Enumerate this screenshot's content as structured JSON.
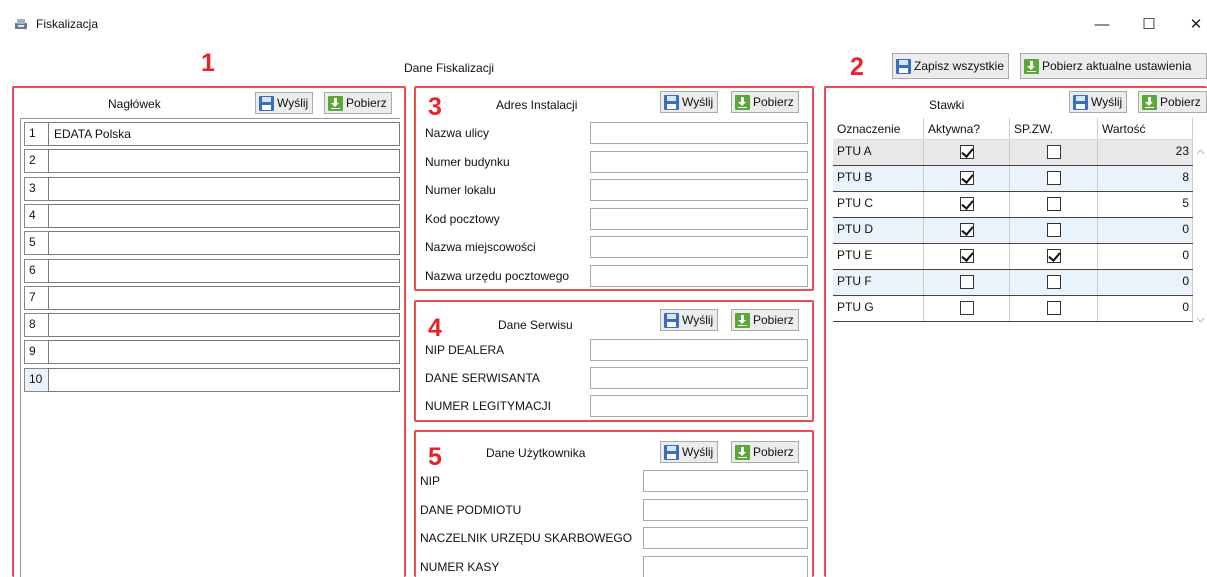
{
  "window": {
    "title": "Fiskalizacja",
    "controls": {
      "minimize": "—",
      "maximize": "☐",
      "close": "✕"
    }
  },
  "main": {
    "center_title": "Dane Fiskalizacji",
    "save_all_label": "Zapisz wszystkie",
    "fetch_settings_label": "Pobierz aktualne ustawienia"
  },
  "labels": {
    "one": "1",
    "two": "2",
    "three": "3",
    "four": "4",
    "five": "5"
  },
  "buttons": {
    "send": "Wyślij",
    "fetch": "Pobierz"
  },
  "header_section": {
    "title": "Nagłówek",
    "rows": [
      {
        "num": "1",
        "value": "EDATA Polska"
      },
      {
        "num": "2",
        "value": ""
      },
      {
        "num": "3",
        "value": ""
      },
      {
        "num": "4",
        "value": ""
      },
      {
        "num": "5",
        "value": ""
      },
      {
        "num": "6",
        "value": ""
      },
      {
        "num": "7",
        "value": ""
      },
      {
        "num": "8",
        "value": ""
      },
      {
        "num": "9",
        "value": ""
      },
      {
        "num": "10",
        "value": ""
      }
    ]
  },
  "address_section": {
    "title": "Adres Instalacji",
    "fields": [
      {
        "label": "Nazwa ulicy",
        "value": ""
      },
      {
        "label": "Numer budynku",
        "value": ""
      },
      {
        "label": "Numer lokalu",
        "value": ""
      },
      {
        "label": "Kod pocztowy",
        "value": ""
      },
      {
        "label": "Nazwa miejscowości",
        "value": ""
      },
      {
        "label": "Nazwa urzędu pocztowego",
        "value": ""
      }
    ]
  },
  "service_section": {
    "title": "Dane Serwisu",
    "fields": [
      {
        "label": "NIP DEALERA",
        "value": ""
      },
      {
        "label": "DANE SERWISANTA",
        "value": ""
      },
      {
        "label": "NUMER LEGITYMACJI",
        "value": ""
      }
    ]
  },
  "user_section": {
    "title": "Dane Użytkownika",
    "fields": [
      {
        "label": "NIP",
        "value": ""
      },
      {
        "label": "DANE PODMIOTU",
        "value": ""
      },
      {
        "label": "NACZELNIK URZĘDU SKARBOWEGO",
        "value": ""
      },
      {
        "label": "NUMER KASY",
        "value": ""
      }
    ]
  },
  "rates_section": {
    "title": "Stawki",
    "columns": [
      "Oznaczenie",
      "Aktywna?",
      "SP.ZW.",
      "Wartość"
    ],
    "rows": [
      {
        "name": "PTU A",
        "active": true,
        "exempt": false,
        "value": "23"
      },
      {
        "name": "PTU B",
        "active": true,
        "exempt": false,
        "value": "8"
      },
      {
        "name": "PTU C",
        "active": true,
        "exempt": false,
        "value": "5"
      },
      {
        "name": "PTU D",
        "active": true,
        "exempt": false,
        "value": "0"
      },
      {
        "name": "PTU E",
        "active": true,
        "exempt": true,
        "value": "0"
      },
      {
        "name": "PTU F",
        "active": false,
        "exempt": false,
        "value": "0"
      },
      {
        "name": "PTU G",
        "active": false,
        "exempt": false,
        "value": "0"
      }
    ]
  },
  "colors": {
    "red_highlight": "#ee4a4f",
    "save_icon": "#3a6fbf",
    "fetch_icon": "#5aa83a",
    "alt_row": "#eaf3fb"
  }
}
